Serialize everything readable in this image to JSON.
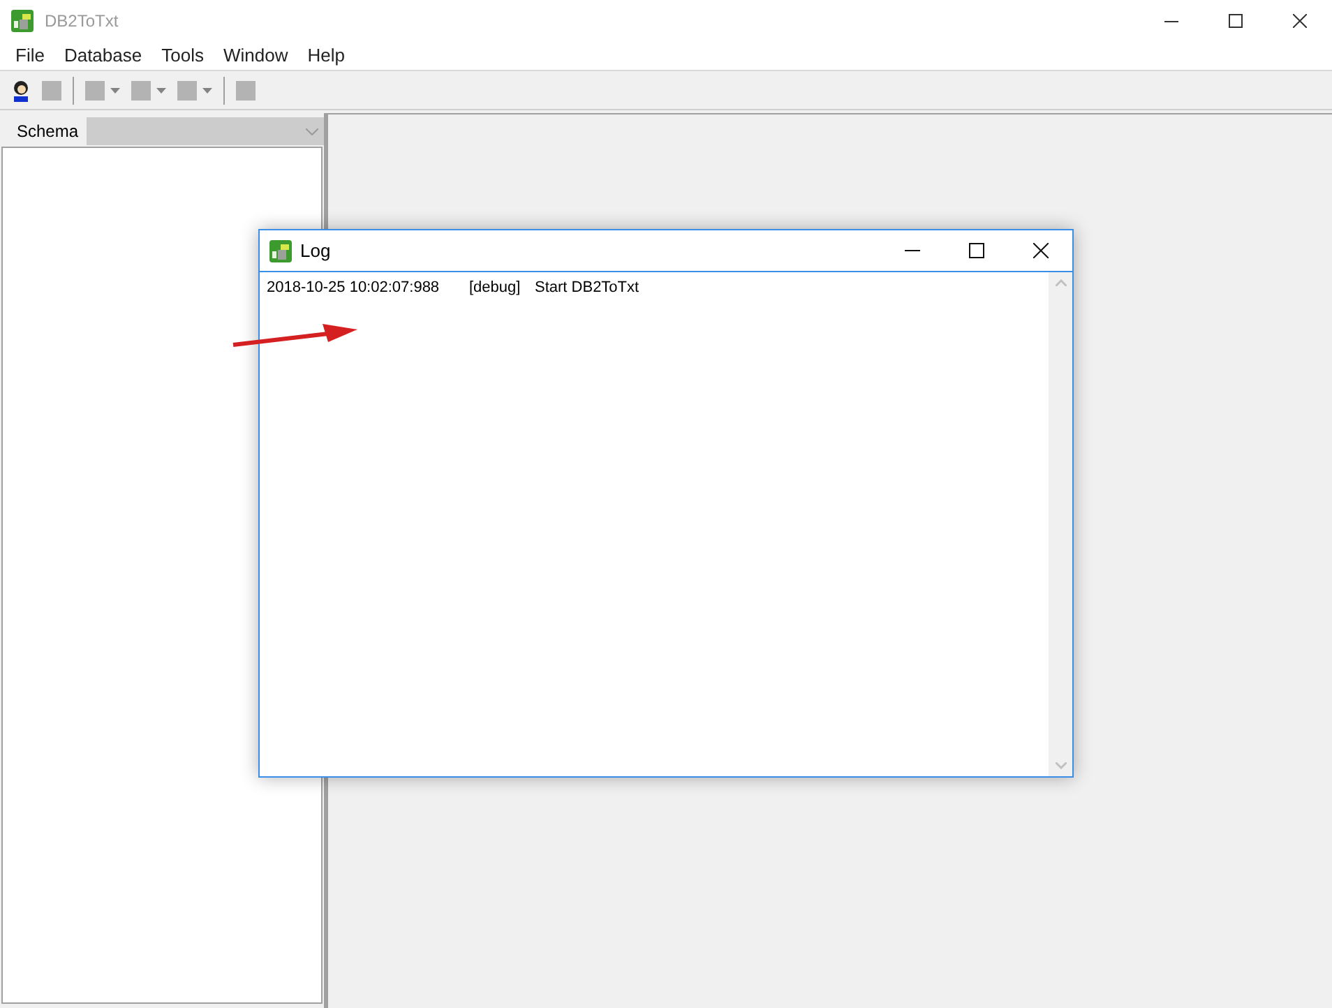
{
  "window": {
    "title": "DB2ToTxt"
  },
  "menu": [
    "File",
    "Database",
    "Tools",
    "Window",
    "Help"
  ],
  "toolbar": [
    {
      "kind": "person",
      "disabled": false
    },
    {
      "kind": "plain",
      "disabled": true
    },
    {
      "kind": "sep"
    },
    {
      "kind": "dropdown",
      "disabled": true
    },
    {
      "kind": "dropdown",
      "disabled": true
    },
    {
      "kind": "dropdown",
      "disabled": true
    },
    {
      "kind": "sep"
    },
    {
      "kind": "plain",
      "disabled": true
    }
  ],
  "schema_panel": {
    "label": "Schema"
  },
  "log_window": {
    "title": "Log",
    "entries": [
      {
        "time": "2018-10-25 10:02:07:988",
        "level": "[debug]",
        "message": "Start DB2ToTxt"
      }
    ]
  }
}
